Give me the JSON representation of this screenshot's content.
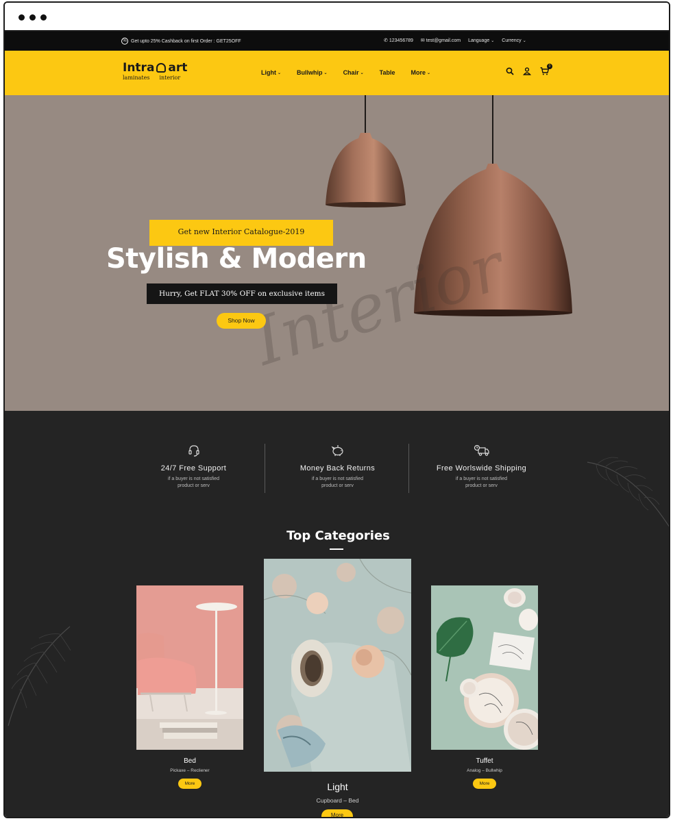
{
  "topbar": {
    "promo": "Get upto 25% Cashback on first Order : GET25OFF",
    "phone": "123456789",
    "email": "test@gmail.com",
    "language": "Language",
    "currency": "Currency"
  },
  "logo": {
    "word1": "Intra",
    "word2": "art",
    "tag1": "laminates",
    "tag2": "interior"
  },
  "nav": [
    {
      "label": "Light",
      "dropdown": true
    },
    {
      "label": "Bullwhip",
      "dropdown": true
    },
    {
      "label": "Chair",
      "dropdown": true
    },
    {
      "label": "Table",
      "dropdown": false
    },
    {
      "label": "More",
      "dropdown": true
    }
  ],
  "cart": {
    "count": "0"
  },
  "hero": {
    "badge": "Get new Interior Catalogue-2019",
    "title": "Stylish & Modern",
    "offer": "Hurry, Get FLAT 30% OFF on exclusive items",
    "button": "Shop Now",
    "script": "Interior"
  },
  "features": [
    {
      "title": "24/7 Free Support",
      "desc1": "if a buyer is not satisfied",
      "desc2": "product or serv"
    },
    {
      "title": "Money Back Returns",
      "desc1": "if a buyer is not satisfied",
      "desc2": "product or serv"
    },
    {
      "title": "Free Worlswide Shipping",
      "desc1": "if a buyer is not satisfied",
      "desc2": "product or serv"
    }
  ],
  "categories": {
    "title": "Top Categories",
    "items": [
      {
        "name": "Bed",
        "sub": "Pickaxe – Recliener",
        "button": "More"
      },
      {
        "name": "Light",
        "sub": "Cupboard – Bed",
        "button": "More"
      },
      {
        "name": "Tuffet",
        "sub": "Analog – Bullwhip",
        "button": "More"
      }
    ]
  },
  "colors": {
    "accent": "#fcc812",
    "hero_bg": "#978a82",
    "dark_bg": "#242424"
  }
}
